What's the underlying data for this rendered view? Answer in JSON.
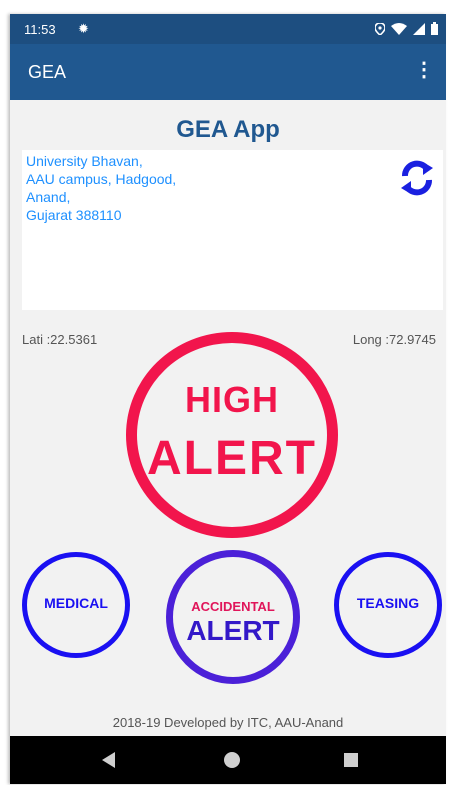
{
  "status_bar": {
    "time": "11:53",
    "icons": [
      "settings-icon",
      "location-icon",
      "wifi-icon",
      "signal-icon",
      "battery-icon"
    ]
  },
  "app_bar": {
    "title": "GEA",
    "menu_icon": "more-vert-icon"
  },
  "main": {
    "heading": "GEA App",
    "address_lines": [
      "University Bhavan,",
      "AAU campus, Hadgood,",
      "Anand,",
      "Gujarat 388110"
    ],
    "refresh_icon": "refresh-icon",
    "latitude_label": "Lati :22.5361",
    "longitude_label": "Long :72.9745"
  },
  "buttons": {
    "high_alert": {
      "line1": "HIGH",
      "line2": "ALERT"
    },
    "medical": {
      "line1": "MEDICAL"
    },
    "accidental": {
      "line1": "ACCIDENTAL",
      "line2": "ALERT"
    },
    "teasing": {
      "line1": "TEASING"
    }
  },
  "footer": {
    "text": "2018-19 Developed by ITC, AAU-Anand"
  },
  "colors": {
    "status_bar": "#1d4e80",
    "app_bar": "#205890",
    "high_alert": "#f2154c",
    "small_buttons": "#1a10f2",
    "accidental_border": "#4b20d8",
    "accidental_text_top": "#e0155a",
    "address_text": "#1e90ff"
  },
  "nav_bar": {
    "buttons": [
      "back-icon",
      "home-icon",
      "recents-icon"
    ]
  }
}
